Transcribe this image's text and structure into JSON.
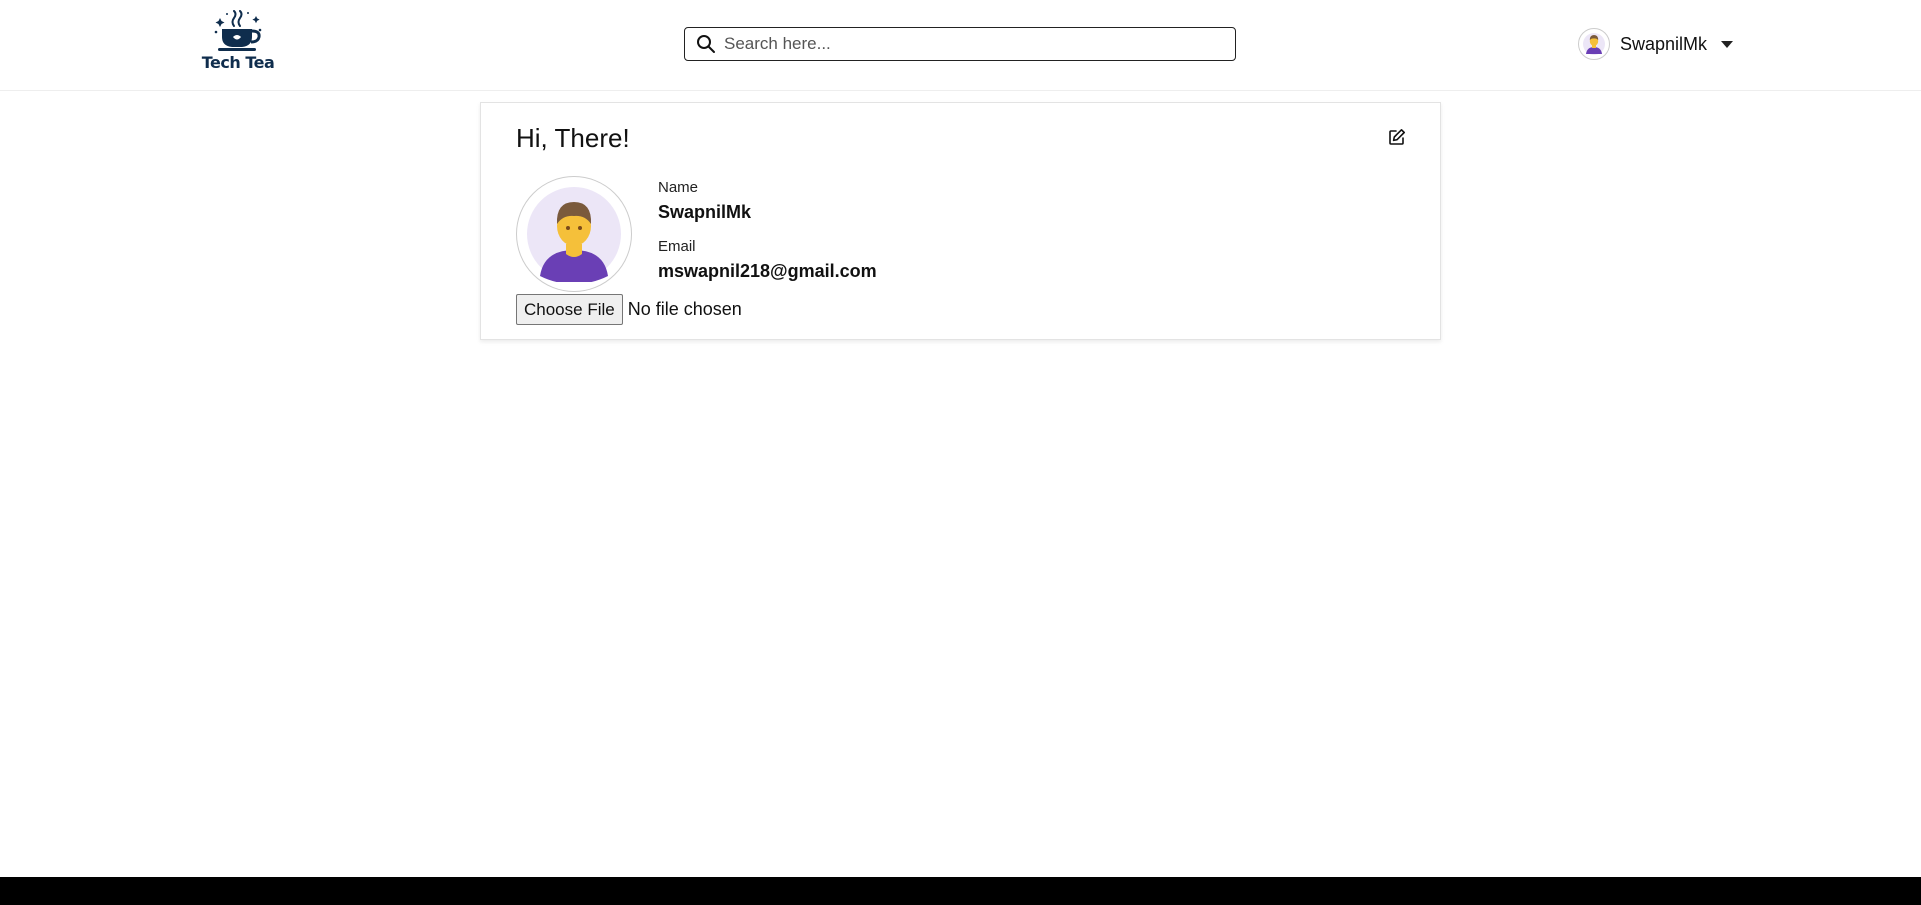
{
  "header": {
    "logo": {
      "text": "Tech Tea",
      "icon": "teacup-logo-icon",
      "color": "#0f2d4d"
    },
    "search": {
      "placeholder": "Search here...",
      "value": "",
      "icon": "search-icon"
    },
    "user": {
      "name": "SwapnilMk",
      "avatar_icon": "user-avatar-icon",
      "dropdown_icon": "caret-down-icon"
    }
  },
  "profile": {
    "greeting": "Hi, There!",
    "edit_icon": "edit-icon",
    "avatar_icon": "user-avatar-icon",
    "name_label": "Name",
    "name_value": "SwapnilMk",
    "email_label": "Email",
    "email_value": "mswapnil218@gmail.com",
    "file_button_label": "Choose File",
    "file_status": "No file chosen"
  },
  "colors": {
    "avatar_shirt": "#6a3fb5",
    "avatar_skin": "#f5c03a",
    "avatar_hair": "#7a5a3c",
    "avatar_bg": "#ece6f7",
    "bottom_bar": "#000000"
  }
}
